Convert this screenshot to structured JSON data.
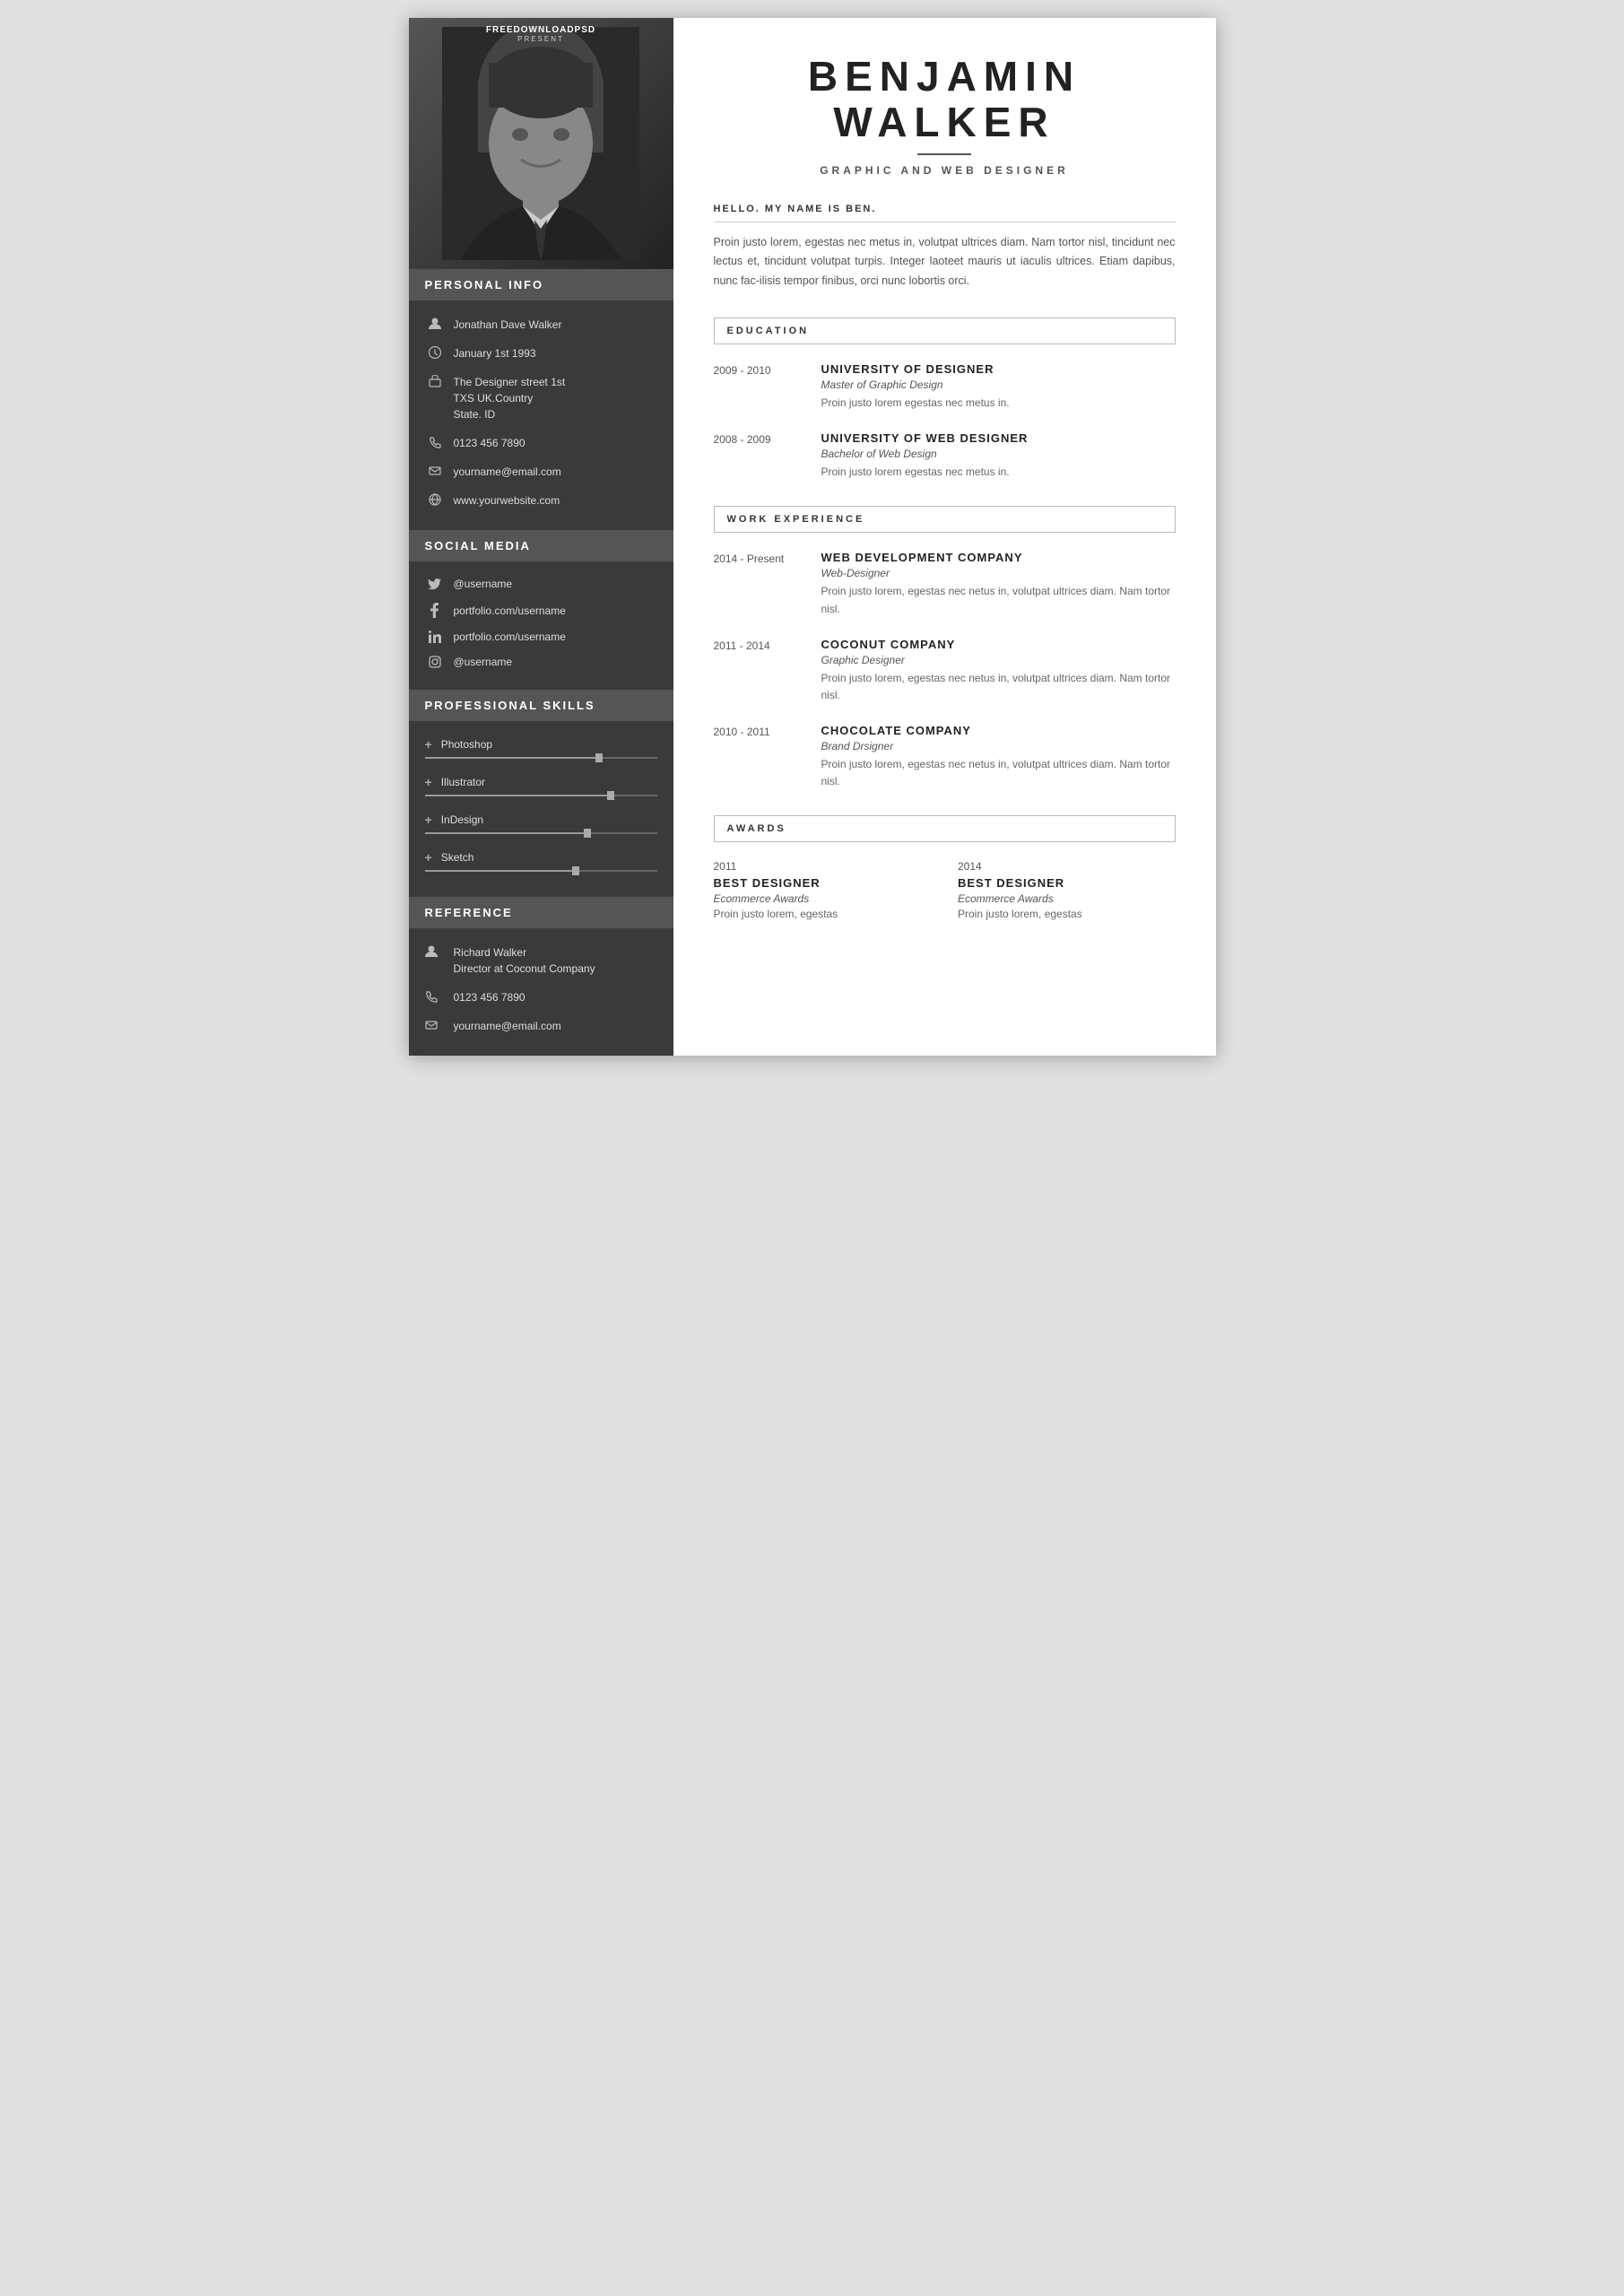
{
  "watermark": {
    "title": "FREEDOWNLOADPSD",
    "sub": "PRESENT"
  },
  "sidebar": {
    "personal_info_label": "PERSONAL INFO",
    "name": "Jonathan Dave Walker",
    "dob": "January 1st 1993",
    "address": "The Designer street 1st\nTXS UK.Country\nState. ID",
    "phone": "0123 456 7890",
    "email": "yourname@email.com",
    "website": "www.yourwebsite.com",
    "social_media_label": "SOCIAL MEDIA",
    "twitter": "@username",
    "facebook": "portfolio.com/username",
    "linkedin": "portfolio.com/username",
    "instagram": "@username",
    "skills_label": "PROFESSIONAL  SKILLS",
    "skills": [
      {
        "name": "Photoshop",
        "percent": 75
      },
      {
        "name": "Illustrator",
        "percent": 80
      },
      {
        "name": "InDesign",
        "percent": 70
      },
      {
        "name": "Sketch",
        "percent": 65
      }
    ],
    "reference_label": "REFERENCE",
    "ref_name": "Richard Walker",
    "ref_role": "Director at Coconut Company",
    "ref_phone": "0123 456 7890",
    "ref_email": "yourname@email.com"
  },
  "main": {
    "first_name": "BENJAMIN",
    "last_name": "WALKER",
    "job_title": "GRAPHIC AND WEB DESIGNER",
    "greeting": "HELLO. MY NAME IS BEN.",
    "intro": "Proin  justo  lorem,  egestas  nec  metus  in,  volutpat  ultrices  diam. Nam tortor nisl, tincidunt  nec  lectus  et,  tincidunt  volutpat turpis. Integer laoteet  mauris ut iaculis  ultrices.  Etiam  dapibus, nunc  fac-ilisis tempor  finibus, orci nunc  lobortis orci.",
    "education_label": "EDUCATION",
    "education": [
      {
        "years": "2009 - 2010",
        "company": "UNIVERSITY OF DESIGNER",
        "role": "Master of Graphic Design",
        "desc": "Proin justo lorem egestas nec metus in."
      },
      {
        "years": "2008 - 2009",
        "company": "UNIVERSITY OF WEB DESIGNER",
        "role": "Bachelor of Web Design",
        "desc": "Proin justo lorem egestas nec metus in."
      }
    ],
    "work_label": "WORK EXPERIENCE",
    "work": [
      {
        "years": "2014 - Present",
        "company": "WEB DEVELOPMENT COMPANY",
        "role": "Web-Designer",
        "desc": "Proin  justo  lorem, egestas  nec  netus  in,  volutpat ultrices diam. Nam tortor nisl."
      },
      {
        "years": "2011 - 2014",
        "company": "COCONUT COMPANY",
        "role": "Graphic Designer",
        "desc": "Proin  justo  lorem, egestas  nec  netus  in,  volutpat ultrices diam. Nam tortor nisl."
      },
      {
        "years": "2010 - 2011",
        "company": "CHOCOLATE  COMPANY",
        "role": "Brand Drsigner",
        "desc": "Proin  justo  lorem, egestas  nec  netus  in,  volutpat ultrices diam. Nam tortor nisl."
      }
    ],
    "awards_label": "AWARDS",
    "awards": [
      {
        "year": "2011",
        "title": "BEST  DESIGNER",
        "org": "Ecommerce Awards",
        "desc": "Proin justo  lorem, egestas"
      },
      {
        "year": "2014",
        "title": "BEST  DESIGNER",
        "org": "Ecommerce Awards",
        "desc": "Proin justo  lorem, egestas"
      }
    ]
  }
}
